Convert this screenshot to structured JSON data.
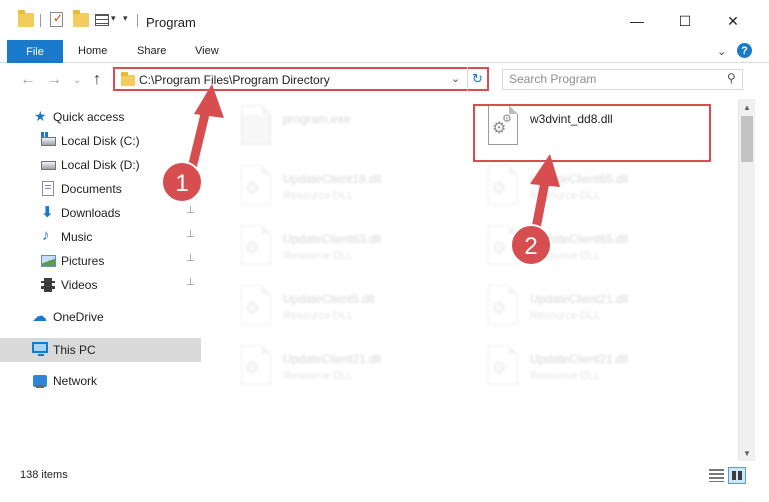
{
  "window": {
    "title": "Program",
    "controls": {
      "minimize": "—",
      "maximize": "☐",
      "close": "✕"
    }
  },
  "ribbon": {
    "tabs": [
      "File",
      "Home",
      "Share",
      "View"
    ],
    "expand_glyph": "⌄",
    "help_glyph": "?"
  },
  "navigation": {
    "back_glyph": "←",
    "forward_glyph": "→",
    "recent_glyph": "⌄",
    "up_glyph": "↑",
    "address_path": "C:\\Program Files\\Program Directory",
    "address_dropdown_glyph": "⌄",
    "refresh_glyph": "↻",
    "search_placeholder": "Search Program",
    "search_glyph": "⚲"
  },
  "sidebar": {
    "items": [
      {
        "label": "Quick access",
        "icon": "star-icon"
      },
      {
        "label": "Local Disk (C:)",
        "icon": "disk-icon"
      },
      {
        "label": "Local Disk (D:)",
        "icon": "disk-icon"
      },
      {
        "label": "Documents",
        "icon": "documents-icon"
      },
      {
        "label": "Downloads",
        "icon": "download-icon",
        "pinned": true
      },
      {
        "label": "Music",
        "icon": "music-icon",
        "pinned": true
      },
      {
        "label": "Pictures",
        "icon": "pictures-icon",
        "pinned": true
      },
      {
        "label": "Videos",
        "icon": "videos-icon",
        "pinned": true
      },
      {
        "label": "OneDrive",
        "icon": "cloud-icon"
      },
      {
        "label": "This PC",
        "icon": "computer-icon",
        "selected": true
      },
      {
        "label": "Network",
        "icon": "network-icon"
      }
    ],
    "pin_glyph": "📌"
  },
  "files": {
    "highlighted": {
      "name": "w3dvint_dd8.dll"
    },
    "exe": {
      "name": "program.exe"
    },
    "items": [
      {
        "name": "UpdateClient19.dll",
        "type": "Resource DLL"
      },
      {
        "name": "UpdateClient65.dll",
        "type": "Resource DLL"
      },
      {
        "name": "UpdateClient63.dll",
        "type": "Resource DLL"
      },
      {
        "name": "UpdateClient65.dll",
        "type": "Resource DLL"
      },
      {
        "name": "UpdateClient5.dll",
        "type": "Resource DLL"
      },
      {
        "name": "UpdateClient21.dll",
        "type": "Resource DLL"
      },
      {
        "name": "UpdateClient21.dll",
        "type": "Resource DLL"
      },
      {
        "name": "UpdateClient21.dll",
        "type": "Resource DLL"
      }
    ]
  },
  "annotations": {
    "step1": "1",
    "step2": "2",
    "color": "#d64e50"
  },
  "status": {
    "item_count": "138 items"
  }
}
